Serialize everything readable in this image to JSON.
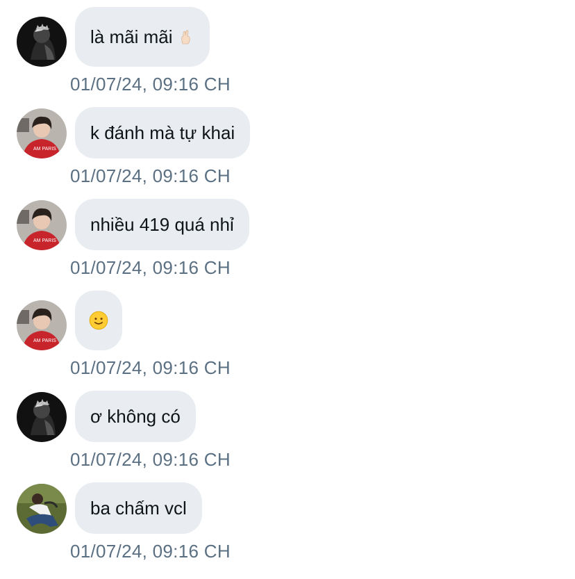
{
  "messages": [
    {
      "author_avatar": "avatar-dark-icon",
      "text": "là mãi mãi",
      "emoji": "fingers-crossed-emoji-icon",
      "timestamp": "01/07/24, 09:16 CH"
    },
    {
      "author_avatar": "avatar-red-hoodie-icon",
      "text": "k đánh mà tự khai",
      "timestamp": "01/07/24, 09:16 CH"
    },
    {
      "author_avatar": "avatar-red-hoodie-icon",
      "text": "nhiều 419 quá nhỉ",
      "timestamp": "01/07/24, 09:16 CH"
    },
    {
      "author_avatar": "avatar-red-hoodie-icon",
      "text": "",
      "emoji": "slightly-smiling-face-emoji-icon",
      "timestamp": "01/07/24, 09:16 CH"
    },
    {
      "author_avatar": "avatar-dark-icon",
      "text": "ơ không có",
      "timestamp": "01/07/24, 09:16 CH"
    },
    {
      "author_avatar": "avatar-outdoor-icon",
      "text": "ba chấm vcl",
      "timestamp": "01/07/24, 09:16 CH"
    }
  ],
  "colors": {
    "bubble_background": "#e9edf1",
    "message_text": "#0f1419",
    "timestamp_text": "#5b7083"
  }
}
